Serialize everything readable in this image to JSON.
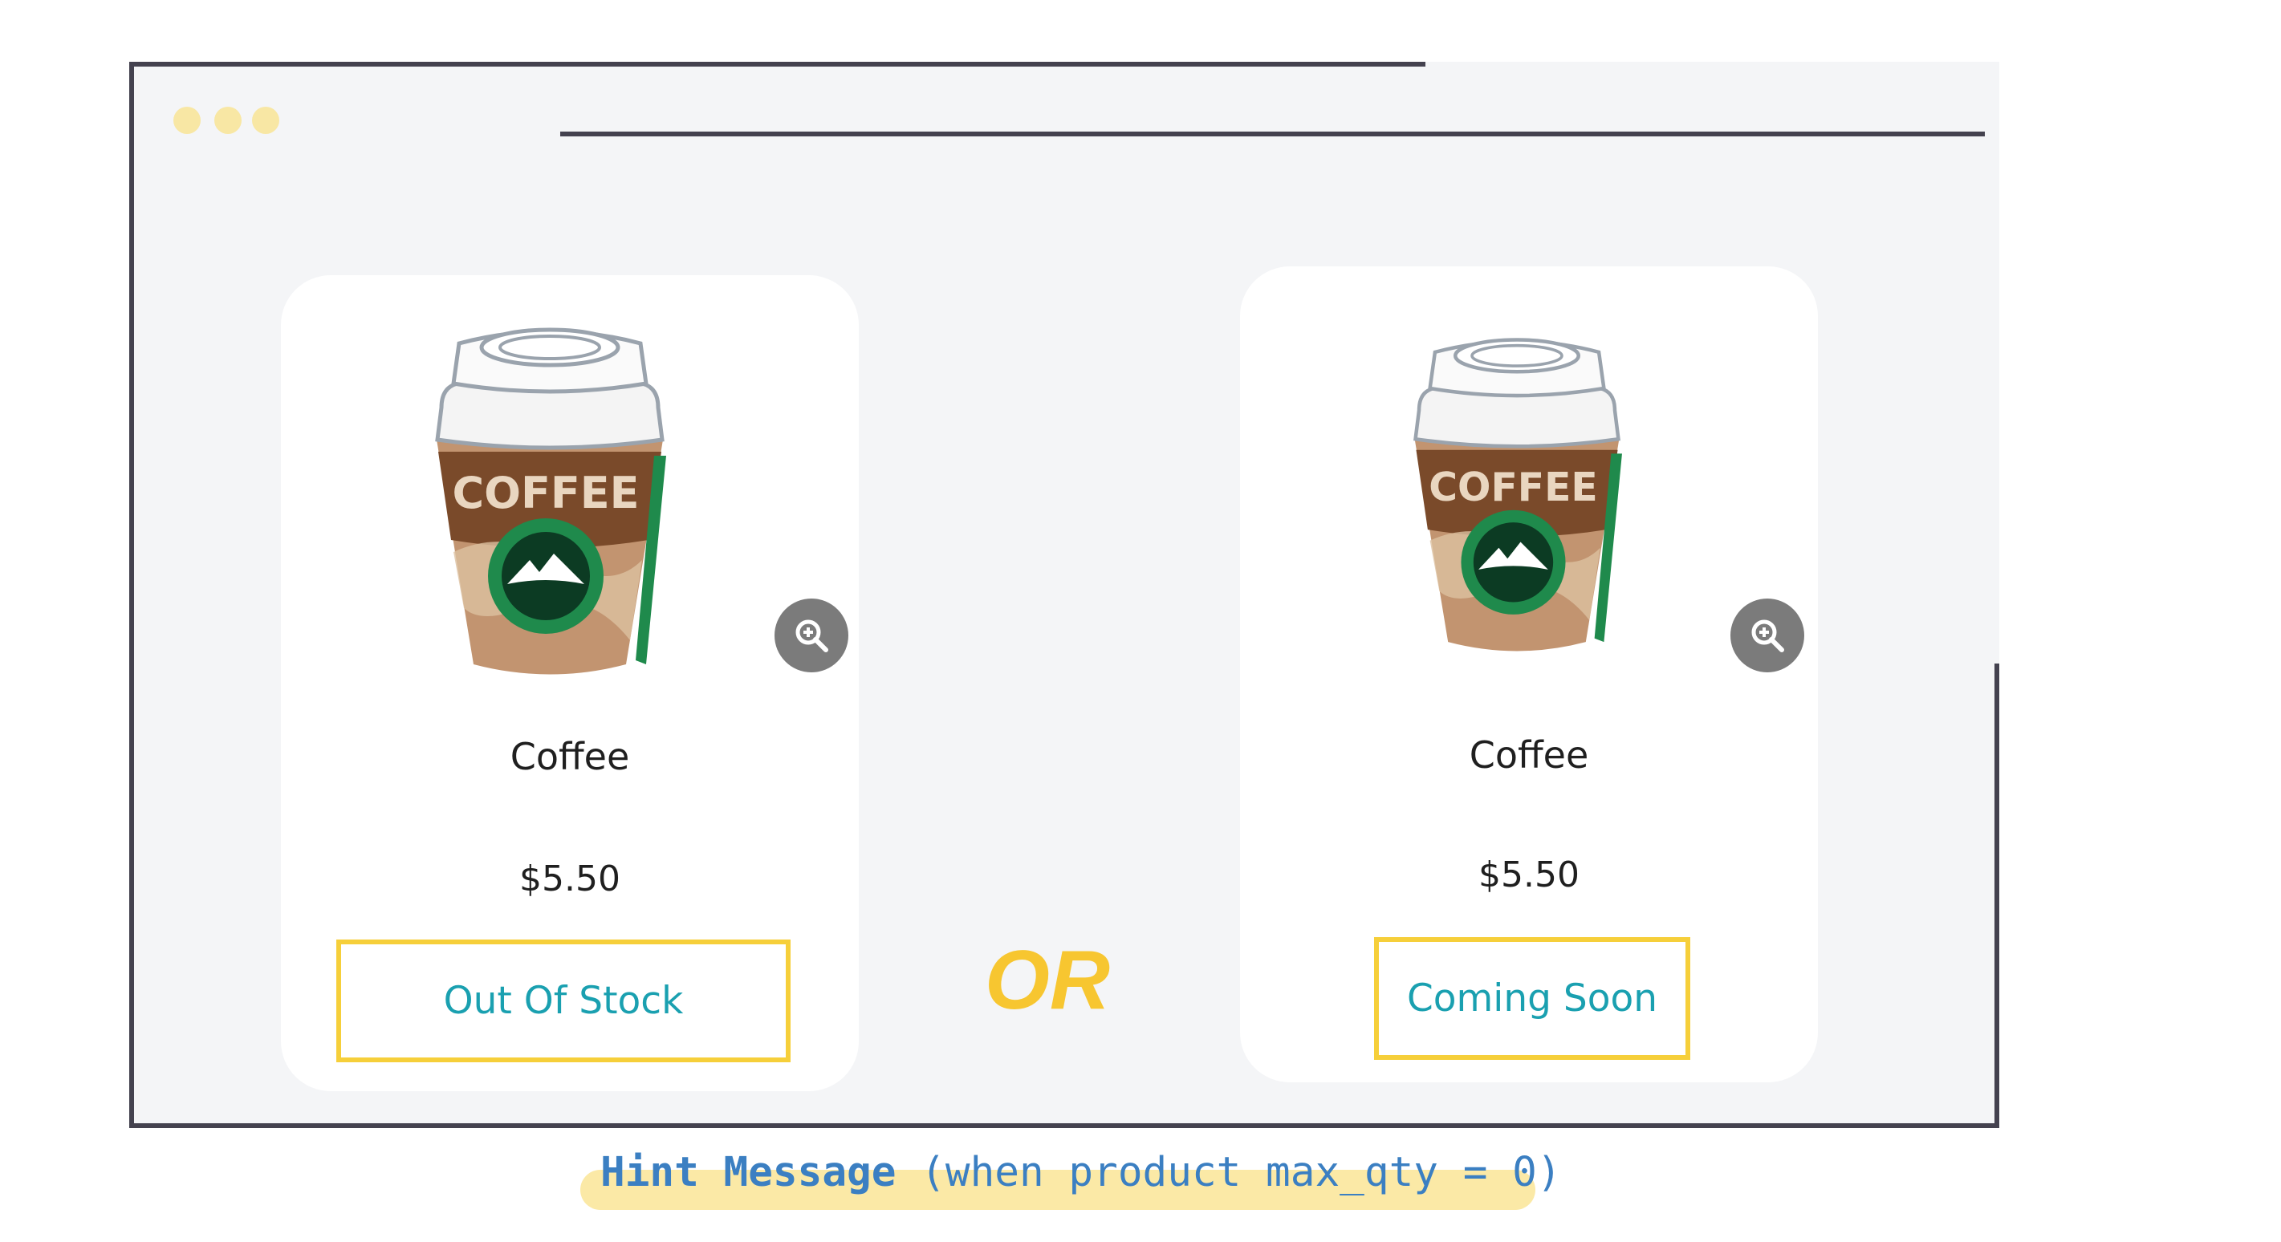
{
  "window": {
    "traffic_dots": [
      "dot",
      "dot",
      "dot"
    ]
  },
  "products": [
    {
      "name": "Coffee",
      "price": "$5.50",
      "image_icon": "coffee-cup-icon",
      "zoom_icon": "zoom-in-icon",
      "button_label": "Out Of Stock"
    },
    {
      "name": "Coffee",
      "price": "$5.50",
      "image_icon": "coffee-cup-icon",
      "zoom_icon": "zoom-in-icon",
      "button_label": "Coming Soon"
    }
  ],
  "separator": "OR",
  "hint": {
    "title": "Hint Message",
    "detail": "(when product max_qty = 0)"
  },
  "colors": {
    "accent_yellow": "#f6cf3a",
    "button_text": "#1aa0b0",
    "frame_border": "#44424f",
    "hint_blue": "#3b7fc2"
  }
}
